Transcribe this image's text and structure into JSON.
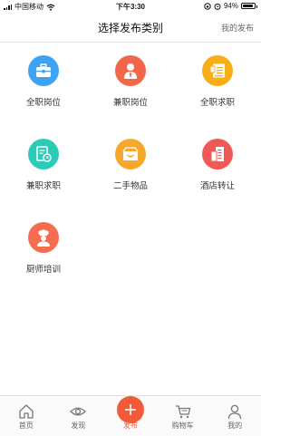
{
  "status_bar": {
    "carrier": "中国移动",
    "time": "下午3:30",
    "battery": "94%",
    "battery_level": 0.94
  },
  "header": {
    "title": "选择发布类别",
    "my_posts_label": "我的发布"
  },
  "categories": [
    {
      "label": "全职岗位",
      "icon": "briefcase-icon",
      "color": "#3ea3f2"
    },
    {
      "label": "兼职岗位",
      "icon": "person-icon",
      "color": "#f2674a"
    },
    {
      "label": "全职求职",
      "icon": "resume-icon",
      "color": "#f7ae17"
    },
    {
      "label": "兼职求职",
      "icon": "document-clock-icon",
      "color": "#2bcbb8"
    },
    {
      "label": "二手物品",
      "icon": "box-icon",
      "color": "#f7a72c"
    },
    {
      "label": "酒店转让",
      "icon": "building-icon",
      "color": "#ef5a57"
    },
    {
      "label": "厨师培训",
      "icon": "chef-icon",
      "color": "#f46d4f"
    }
  ],
  "tabs": [
    {
      "label": "首页",
      "icon": "home-icon"
    },
    {
      "label": "发现",
      "icon": "eye-icon"
    },
    {
      "label": "发布",
      "icon": "plus-icon",
      "active": true
    },
    {
      "label": "购物车",
      "icon": "cart-icon"
    },
    {
      "label": "我的",
      "icon": "user-icon"
    }
  ],
  "colors": {
    "accent": "#f25b3a"
  }
}
